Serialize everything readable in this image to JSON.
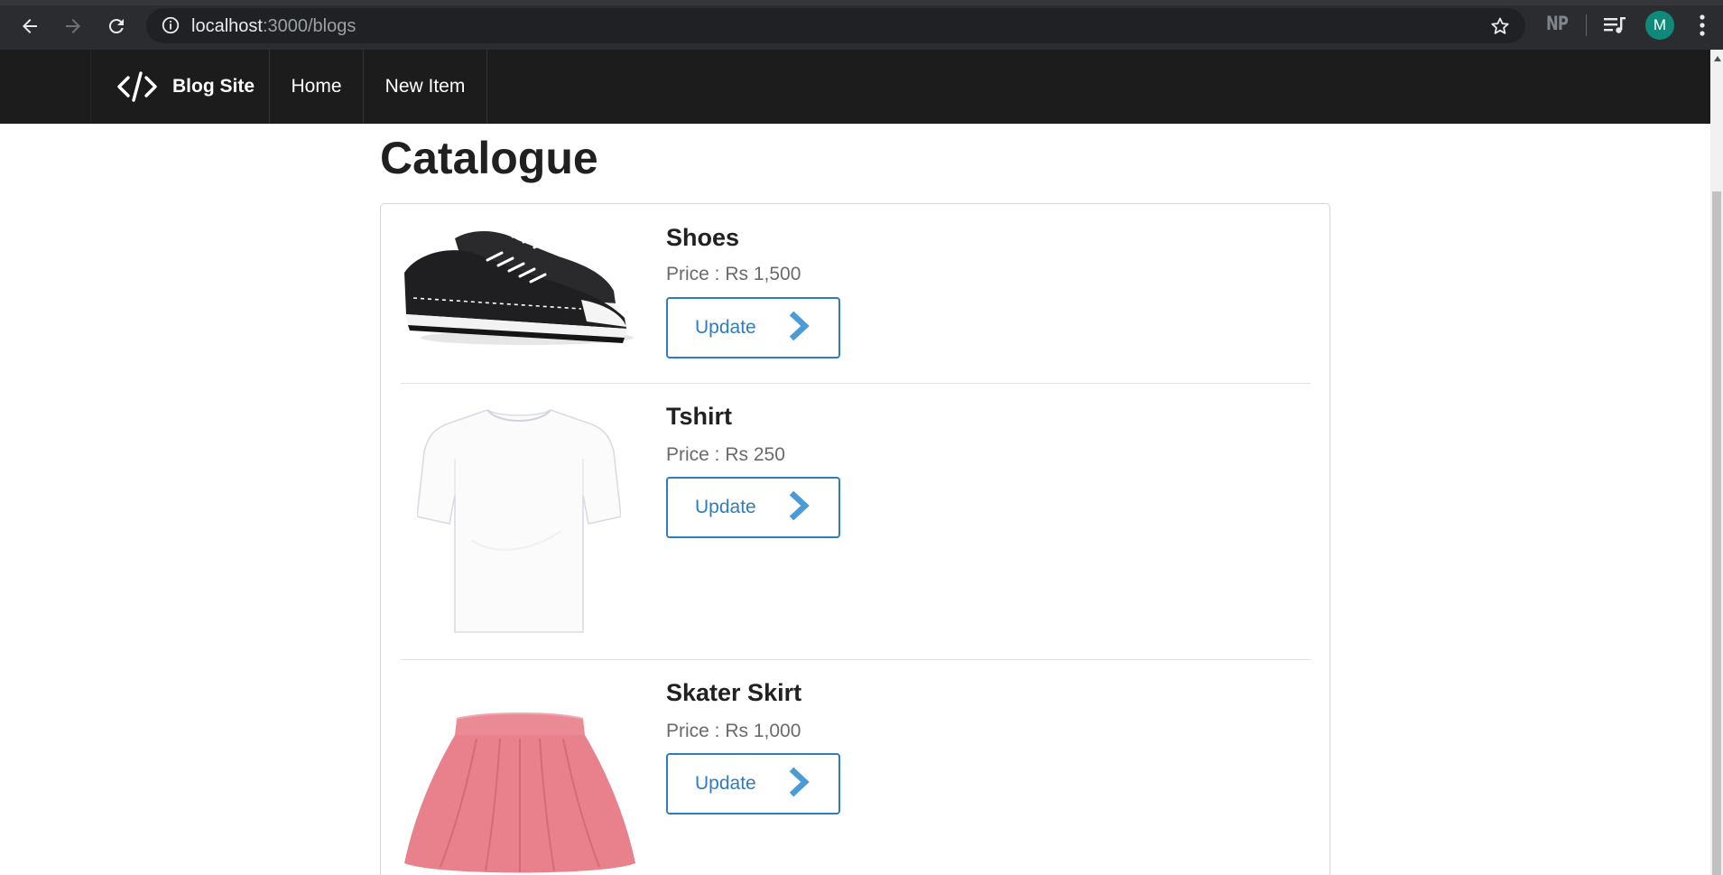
{
  "browser": {
    "url_host": "localhost",
    "url_path": ":3000/blogs",
    "extension_label": "NP",
    "avatar_initial": "M"
  },
  "navbar": {
    "brand": "Blog Site",
    "links": [
      {
        "label": "Home"
      },
      {
        "label": "New Item"
      }
    ]
  },
  "page": {
    "title": "Catalogue"
  },
  "items": [
    {
      "name": "Shoes",
      "price": "Price : Rs 1,500",
      "button": "Update",
      "image_icon": "sneaker-image"
    },
    {
      "name": "Tshirt",
      "price": "Price : Rs 250",
      "button": "Update",
      "image_icon": "tshirt-image"
    },
    {
      "name": "Skater Skirt",
      "price": "Price : Rs 1,000",
      "button": "Update",
      "image_icon": "skirt-image"
    }
  ],
  "colors": {
    "navbar_bg": "#1c1c1c",
    "button_accent": "#2f7dbf",
    "chevron": "#4a9bd6",
    "avatar_bg": "#0f8a7a"
  }
}
